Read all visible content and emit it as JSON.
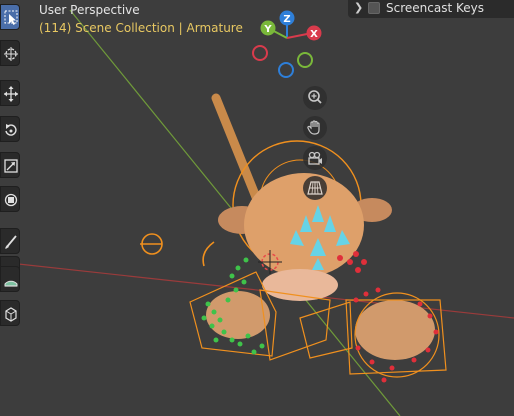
{
  "viewport": {
    "perspective_label": "User Perspective",
    "collection_label": "(114) Scene Collection | Armature"
  },
  "overlay_panel": {
    "expand_icon": "chevron-right-icon",
    "checkbox_checked": false,
    "label": "Screencast Keys"
  },
  "gizmo": {
    "axes": [
      {
        "label": "Z",
        "color": "#2e7fd9"
      },
      {
        "label": "Y",
        "color": "#7ab83a"
      },
      {
        "label": "X",
        "color": "#d93b4c"
      }
    ]
  },
  "nav_buttons": [
    "zoom-icon",
    "hand-pan-icon",
    "camera-icon",
    "grid-ortho-icon"
  ],
  "tools": [
    "select-box-icon",
    "cursor-icon",
    "move-icon",
    "rotate-icon",
    "scale-icon",
    "transform-icon",
    "annotate-icon",
    "measure-icon",
    "add-cube-icon"
  ],
  "colors": {
    "viewport_bg": "#3d3d3d",
    "selected_outline": "#f0901e",
    "active_tool": "#4a6ea9",
    "text_highlight": "#e8c862"
  }
}
